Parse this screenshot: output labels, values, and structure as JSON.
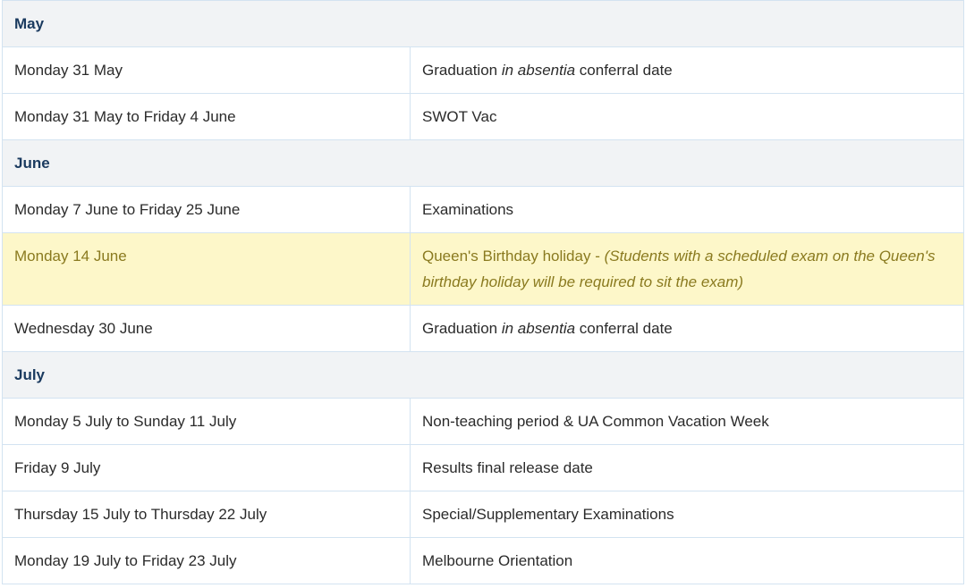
{
  "sections": [
    {
      "month": "May",
      "rows": [
        {
          "date": "Monday 31 May",
          "event_pre": "Graduation ",
          "event_em": "in absentia",
          "event_post": " conferral date"
        },
        {
          "date": "Monday 31 May to Friday 4 June",
          "event": "SWOT Vac"
        }
      ]
    },
    {
      "month": "June",
      "rows": [
        {
          "date": "Monday 7 June to Friday 25 June",
          "event": "Examinations"
        },
        {
          "date": "Monday 14 June",
          "event": "Queen's Birthday holiday - ",
          "note": "(Students with a scheduled exam on the Queen's birthday holiday will be required to sit the exam)",
          "highlight": true,
          "highlight_color": "#fdf7c9"
        },
        {
          "date": "Wednesday 30 June",
          "event_pre": "Graduation ",
          "event_em": "in absentia",
          "event_post": " conferral date"
        }
      ]
    },
    {
      "month": "July",
      "rows": [
        {
          "date": "Monday 5 July to Sunday 11 July",
          "event": "Non-teaching period & UA Common Vacation Week"
        },
        {
          "date": "Friday 9 July",
          "event": "Results final release date"
        },
        {
          "date": "Thursday 15 July to Thursday 22 July",
          "event": "Special/Supplementary Examinations"
        },
        {
          "date": "Monday 19 July to Friday 23 July",
          "event": "Melbourne Orientation"
        }
      ]
    }
  ],
  "colors": {
    "month_header_bg": "#f1f3f5",
    "month_header_text": "#1a3a5f",
    "border": "#d3e3f1",
    "highlight_bg": "#fdf7c9",
    "highlight_text": "#8a7a1f"
  }
}
